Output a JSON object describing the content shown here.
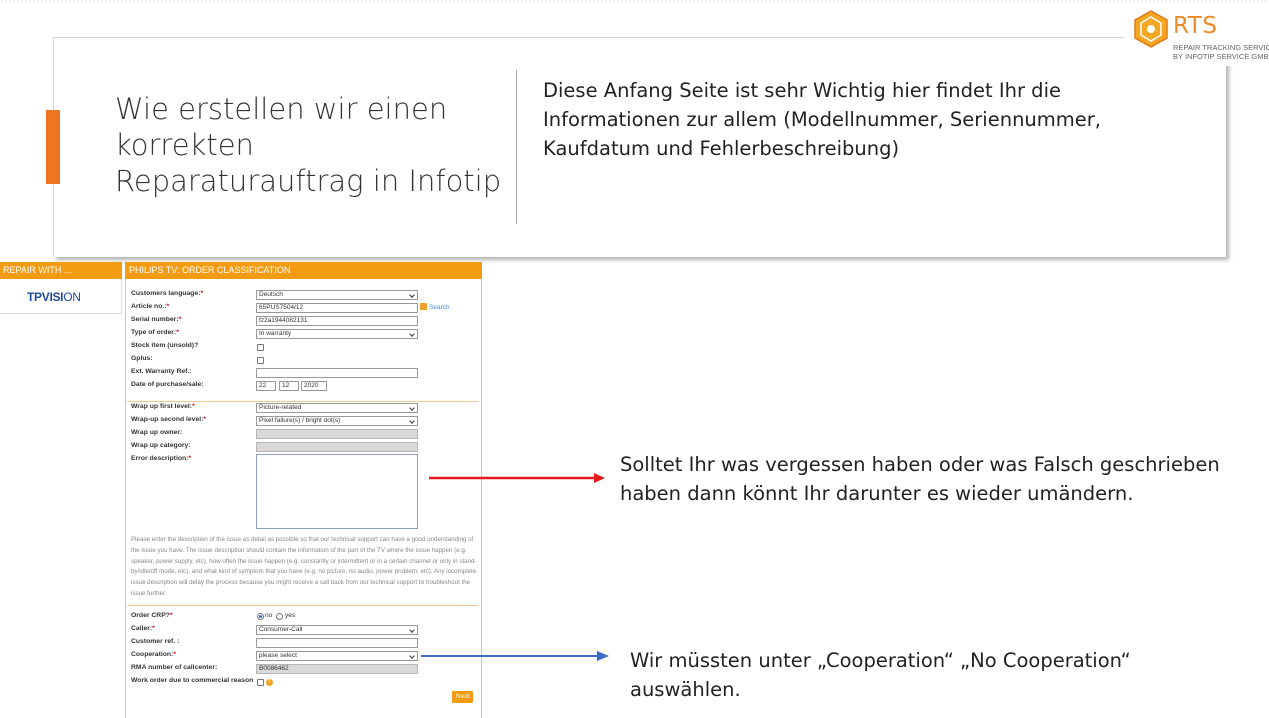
{
  "header": {
    "title_lines": [
      "Wie erstellen wir einen",
      "korrekten",
      "Reparaturauftrag in Infotip"
    ],
    "description_lines": [
      "Diese Anfang Seite ist sehr Wichtig hier findet Ihr die",
      "Informationen zur allem (Modellnummer, Seriennummer,",
      "Kaufdatum und Fehlerbeschreibung)"
    ]
  },
  "logo": {
    "name": "RTS",
    "line1": "REPAIR TRACKING SERVICE",
    "line2": "BY INFOTIP SERVICE GMBH",
    "color": "#ee8a2a"
  },
  "repair_panel": {
    "header": "REPAIR WITH ...",
    "brand_bold": "TPVISI",
    "brand_thin": "ON"
  },
  "form": {
    "header": "PHILIPS TV: ORDER CLASSIFICATION",
    "customers_language": {
      "label": "Customers language:",
      "value": "Deutsch"
    },
    "article_no": {
      "label": "Article no.:",
      "value": "65PUS7504/12",
      "search": "Search"
    },
    "serial_number": {
      "label": "Serial number:",
      "value": "fz2a1944082131"
    },
    "type_of_order": {
      "label": "Type of order:",
      "value": "In warranty"
    },
    "stock_item": {
      "label": "Stock item (unsold)?"
    },
    "gplus": {
      "label": "Gplus:"
    },
    "ext_warranty": {
      "label": "Ext. Warranty Ref.:",
      "value": ""
    },
    "date_of_purchase": {
      "label": "Date of purchase/sale:",
      "day": "22",
      "month": "12",
      "year": "2020"
    },
    "wrap_first": {
      "label": "Wrap up first level:",
      "value": "Picture-related"
    },
    "wrap_second": {
      "label": "Wrap-up second level:",
      "value": "Pixel failure(s) / bright dot(s)"
    },
    "wrap_owner": {
      "label": "Wrap up owner:"
    },
    "wrap_category": {
      "label": "Wrap up category:"
    },
    "error_description": {
      "label": "Error description:"
    },
    "note": "Please enter the description of the issue as detail as possible so that our technical support can have a good understanding of the issue you have. The issue description should contain the information of the part of the TV where the issue happen (e.g. speaker, power supply, etc), how often the issue happen (e.g. constantly or intermittent or in a certain channel or only in stand-by/idle/off mode, etc), and what kind of symptom that you have (e.g. no picture, no audio, power problem, etc). Any incomplete issue description will delay the process because you might receive a call back from our technical support to troubleshoot the issue further.",
    "order_crp": {
      "label": "Order CRP?",
      "no": "no",
      "yes": "yes"
    },
    "caller": {
      "label": "Caller:",
      "value": "Consumer-Call"
    },
    "customer_ref": {
      "label": "Customer ref. :",
      "value": ""
    },
    "cooperation": {
      "label": "Cooperation:",
      "value": "please select"
    },
    "rma_number": {
      "label": "RMA number of callcenter:",
      "value": "B0086462"
    },
    "work_order": {
      "label": "Work order due to commercial reason"
    },
    "next_label": "Next"
  },
  "annotations": {
    "error_note_lines": [
      "Solltet Ihr was vergessen haben oder was Falsch geschrieben",
      "haben dann könnt Ihr darunter es wieder umändern."
    ],
    "coop_note_lines": [
      "Wir müssten unter „Cooperation“ „No Cooperation“",
      "auswählen."
    ],
    "red_arrow_color": "#e21a1a",
    "blue_arrow_color": "#3b6cc8"
  }
}
